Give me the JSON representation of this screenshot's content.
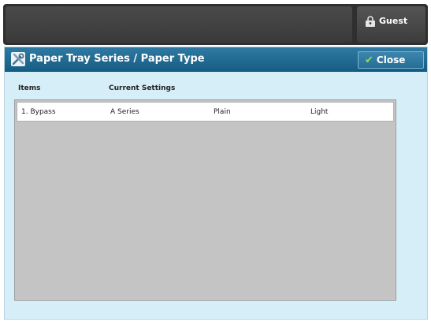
{
  "header": {
    "user_label": "Guest",
    "user_icon": "lock-person-icon"
  },
  "dialog": {
    "title": "Paper Tray Series / Paper Type",
    "title_icon": "tools-icon",
    "close_label": "Close",
    "close_icon": "check-icon",
    "colors": {
      "titlebar": "#155c84",
      "panel": "#d6eef7",
      "list_bg": "#c4c4c4",
      "check": "#8ee04f"
    }
  },
  "table": {
    "headers": [
      "Items",
      "Current Settings"
    ],
    "rows": [
      {
        "item": "1. Bypass",
        "series": "A Series",
        "type": "Plain",
        "weight": "Light"
      }
    ]
  }
}
